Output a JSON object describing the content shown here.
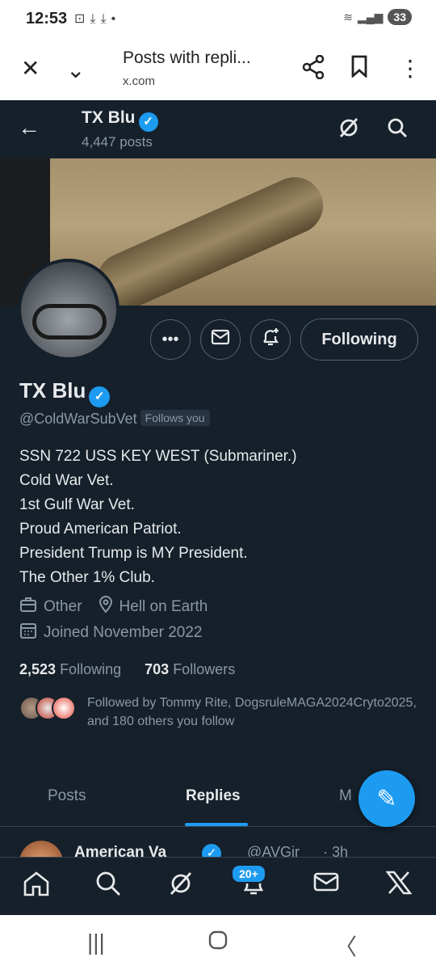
{
  "status_bar": {
    "time": "12:53",
    "battery": "33",
    "icons": [
      "screenshot-icon",
      "download-icon",
      "download-icon",
      "dot-icon",
      "wifi-icon",
      "signal-icon",
      "battery-icon"
    ]
  },
  "browser": {
    "title": "Posts with repli...",
    "url": "x.com",
    "icons": [
      "close-icon",
      "chevron-down-icon",
      "share-icon",
      "bookmark-icon",
      "more-vertical-icon"
    ]
  },
  "header": {
    "name": "TX Blu",
    "post_count": "4,447 posts"
  },
  "profile": {
    "name": "TX Blu",
    "handle": "@ColdWarSubVet",
    "follows_you": "Follows you",
    "follow_button": "Following",
    "bio_lines": [
      "SSN 722 USS KEY WEST (Submariner.)",
      "Cold War Vet.",
      "1st Gulf War Vet.",
      "Proud American Patriot.",
      "President Trump is MY President.",
      "The Other 1% Club."
    ],
    "category": "Other",
    "location": "Hell on Earth",
    "joined": "Joined November 2022",
    "following_count": "2,523",
    "following_label": "Following",
    "followers_count": "703",
    "followers_label": "Followers",
    "followed_by": "Followed by Tommy Rite, DogsruleMAGA2024Cryto2025, and 180 others you follow"
  },
  "tabs": [
    {
      "label": "Posts",
      "active": false
    },
    {
      "label": "Replies",
      "active": true
    },
    {
      "label": "M",
      "active": false
    }
  ],
  "post": {
    "name": "American Va",
    "handle": "@AVGir",
    "time": "· 3h"
  },
  "bottom_nav": {
    "notification_badge": "20+",
    "icons": [
      "home-icon",
      "search-icon",
      "grok-icon",
      "notifications-icon",
      "messages-icon",
      "x-logo-icon"
    ]
  },
  "colors": {
    "background": "#15202b",
    "accent": "#1d9bf0",
    "muted_text": "#8b98a5"
  }
}
